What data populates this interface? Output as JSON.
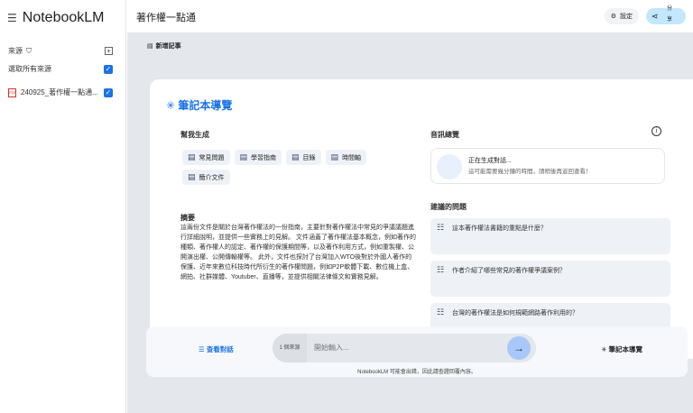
{
  "app": {
    "name": "NotebookLM"
  },
  "sidebar": {
    "sources_label": "來源",
    "select_all": "選取所有來源",
    "sources": [
      {
        "name": "240925_著作權一點通..."
      }
    ]
  },
  "header": {
    "title": "著作權一點通",
    "settings": "設定",
    "share": "分享"
  },
  "main": {
    "new_note": "新增記事",
    "card": {
      "title": "筆記本導覽",
      "generate_heading": "幫我生成",
      "chips": [
        "常見問題",
        "學習指南",
        "目錄",
        "時間軸",
        "簡介文件"
      ],
      "summary_heading": "摘要",
      "summary": "這兩份文件是關於台灣著作權法的一份指南，主要針對著作權法中常見的爭議議題進行詳細說明，並提供一些實務上的見解。 文件涵蓋了著作權法基本概念，例如著作的種類、著作權人的認定、著作權的保護期間等，以及著作利用方式，例如重製權、公開演出權、公開傳輸權等。 此外，文件也探討了台灣加入WTO後對於外國人著作的保護、近年來數位科技時代所衍生的著作權問題，例如P2P軟體下載、數位機上盒、網拍、社群媒體、Youtuber、直播等，並提供相關法律條文和實務見解。",
      "audio_heading": "音訊總覽",
      "audio_status": "正在生成對話...",
      "audio_note": "這可能需要幾分鐘的時間，請稍後再返回查看！",
      "suggested_heading": "建議的問題",
      "questions": [
        "這本著作權法書籍的重點是什麼？",
        "作者介紹了哪些常見的著作權爭議案例？",
        "台灣的著作權法是如何規範網路著作利用的？"
      ]
    },
    "bottom": {
      "view_chat": "查看對話",
      "source_count": "1 個來源",
      "input_placeholder": "開始輸入...",
      "guide": "筆記本導覽",
      "disclaimer": "NotebookLM 可能會出錯，因此請查證回覆內容。"
    }
  },
  "colors": {
    "accent": "#1a73e8",
    "share": "#c2e7ff",
    "send": "#a8c7fa"
  }
}
